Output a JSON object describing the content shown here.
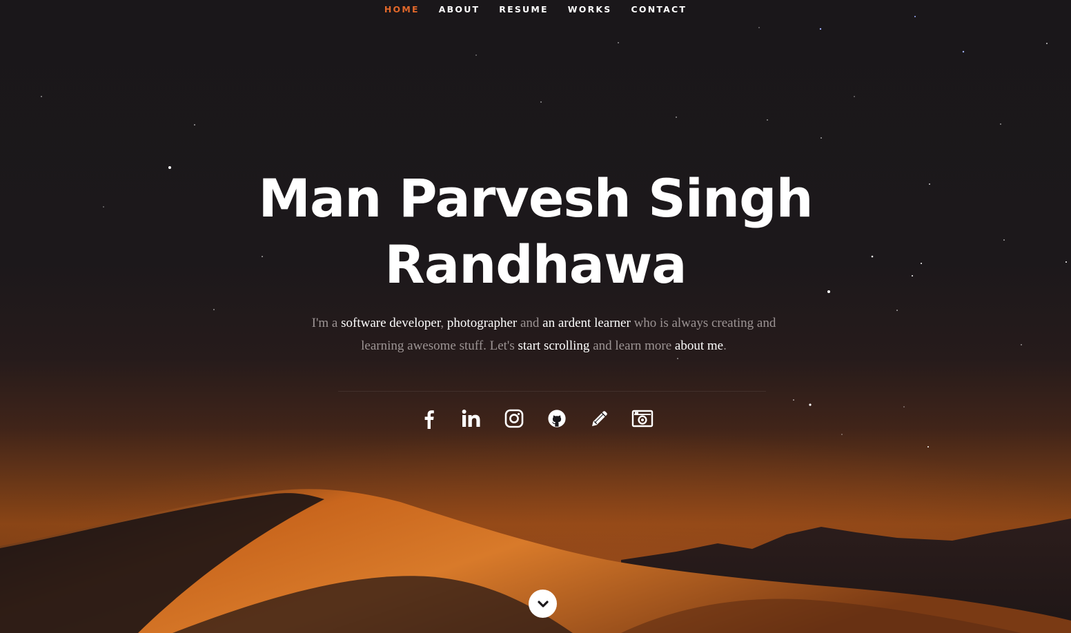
{
  "nav": {
    "items": [
      {
        "label": "HOME",
        "active": true
      },
      {
        "label": "ABOUT",
        "active": false
      },
      {
        "label": "RESUME",
        "active": false
      },
      {
        "label": "WORKS",
        "active": false
      },
      {
        "label": "CONTACT",
        "active": false
      }
    ]
  },
  "hero": {
    "title_line1": "Man Parvesh Singh",
    "title_line2": "Randhawa",
    "bio": {
      "p1": "I'm a ",
      "h1": "software developer",
      "p2": ", ",
      "h2": "photographer",
      "p3": " and ",
      "h3": "an ardent learner",
      "p4": " who is always creating and learning awesome stuff. Let's ",
      "h4": "start scrolling",
      "p5": " and learn more ",
      "h5": "about me",
      "p6": "."
    }
  },
  "social": [
    {
      "icon": "facebook-icon"
    },
    {
      "icon": "linkedin-icon"
    },
    {
      "icon": "instagram-icon"
    },
    {
      "icon": "github-icon"
    },
    {
      "icon": "pencil-icon"
    },
    {
      "icon": "camera-icon"
    }
  ],
  "scroll_button": {
    "icon": "chevron-down-icon"
  },
  "colors": {
    "accent": "#e2682a",
    "text": "#ffffff",
    "muted_text": "#9c9494",
    "background": "#1b181b"
  }
}
